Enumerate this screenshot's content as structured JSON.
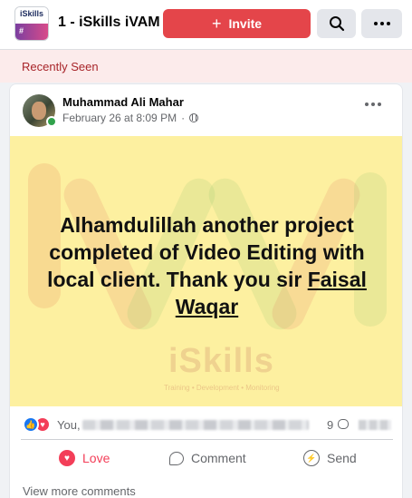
{
  "header": {
    "logo_top": "iSkills",
    "logo_bottom": "#",
    "title": "1 - iSkills iVAM",
    "invite_label": "Invite",
    "invite_plus": "+"
  },
  "recent": {
    "label": "Recently Seen"
  },
  "post": {
    "author": "Muhammad Ali Mahar",
    "timestamp": "February 26 at 8:09 PM",
    "separator": "·",
    "text_before_mention": "Alhamdulillah another project completed of Video Editing with local client. Thank you sir ",
    "mention": "Faisal Waqar",
    "watermark_brand": "iSkills",
    "watermark_tagline": "Training • Development • Monitoring"
  },
  "reactions": {
    "names_prefix": "You,",
    "comment_count": "9"
  },
  "actions": {
    "love": "Love",
    "comment": "Comment",
    "send": "Send"
  },
  "footer": {
    "view_more": "View more comments"
  },
  "colors": {
    "invite_red": "#e4454a",
    "recent_red": "#a8252a",
    "post_bg": "#fdf0a0",
    "love": "#f33e58",
    "like": "#1877f2"
  },
  "icons": [
    "search-icon",
    "more-icon",
    "globe-icon",
    "like-reaction-icon",
    "love-reaction-icon",
    "heart-icon",
    "comment-icon",
    "messenger-icon"
  ]
}
